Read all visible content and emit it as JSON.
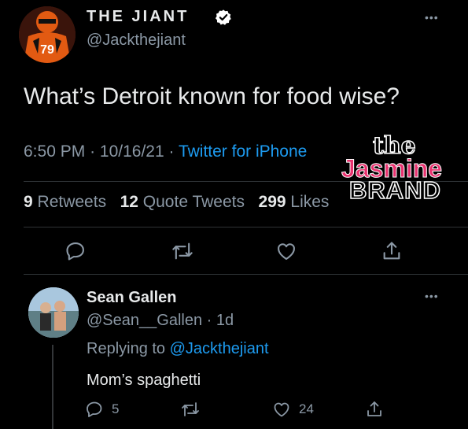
{
  "main_tweet": {
    "display_name": "THE JIANT",
    "handle": "@Jackthejiant",
    "avatar_jersey": "79",
    "more": "•••",
    "text": "What’s Detroit known for food wise?",
    "time": "6:50 PM",
    "date": "10/16/21",
    "source": "Twitter for iPhone",
    "stats": {
      "retweets_count": "9",
      "retweets_label": "Retweets",
      "quotes_count": "12",
      "quotes_label": "Quote Tweets",
      "likes_count": "299",
      "likes_label": "Likes"
    },
    "actions": [
      "reply-icon",
      "retweet-icon",
      "like-icon",
      "share-icon"
    ]
  },
  "watermark": {
    "line1": "the",
    "line2": "Jasmine",
    "line3": "BRAND"
  },
  "reply": {
    "display_name": "Sean Gallen",
    "handle": "@Sean__Gallen",
    "age": "1d",
    "replying_label": "Replying to",
    "replying_to": "@Jackthejiant",
    "text": "Mom’s spaghetti",
    "more": "•••",
    "reply_count": "5",
    "like_count": "24"
  },
  "colors": {
    "background": "#000000",
    "text": "#e7e9ea",
    "muted": "#8b98a5",
    "link": "#1d9bf0",
    "divider": "#2f3336"
  }
}
